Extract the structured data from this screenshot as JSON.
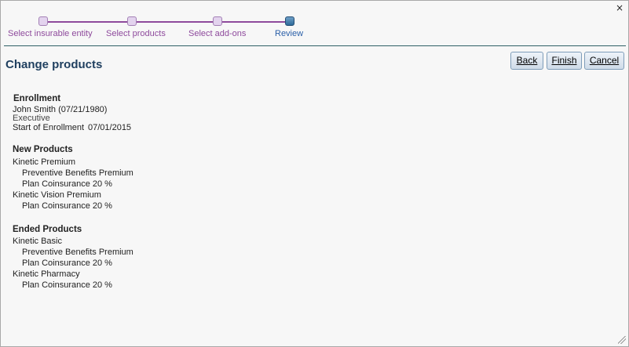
{
  "window": {
    "close_glyph": "×"
  },
  "steps": [
    {
      "label": "Select insurable entity"
    },
    {
      "label": "Select products"
    },
    {
      "label": "Select add-ons"
    },
    {
      "label": "Review"
    }
  ],
  "page": {
    "title": "Change products"
  },
  "buttons": {
    "back": "Back",
    "finish": "Finish",
    "cancel": "Cancel"
  },
  "enrollment": {
    "heading": "Enrollment",
    "name": "John Smith (07/21/1980)",
    "role": "Executive",
    "start_label": "Start of Enrollment",
    "start_date": "07/01/2015"
  },
  "new_products": {
    "heading": "New Products",
    "products": [
      {
        "name": "Kinetic Premium",
        "items": [
          "Preventive Benefits Premium",
          "Plan Coinsurance 20 %"
        ]
      },
      {
        "name": "Kinetic Vision Premium",
        "items": [
          "Plan Coinsurance 20 %"
        ]
      }
    ]
  },
  "ended_products": {
    "heading": "Ended Products",
    "products": [
      {
        "name": "Kinetic Basic",
        "items": [
          "Preventive Benefits Premium",
          "Plan Coinsurance 20 %"
        ]
      },
      {
        "name": "Kinetic Pharmacy",
        "items": [
          "Plan Coinsurance 20 %"
        ]
      }
    ]
  },
  "colors": {
    "accent": "#8e4a9c",
    "active_step": "#2a5fa8",
    "title": "#1f3f5f"
  }
}
